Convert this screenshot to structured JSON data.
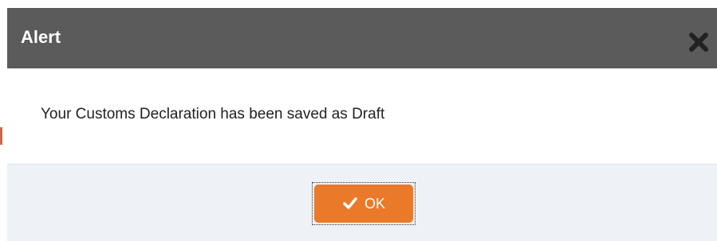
{
  "dialog": {
    "title": "Alert",
    "message": "Your Customs Declaration has been saved as Draft",
    "ok_label": "OK",
    "close_icon": "close-icon",
    "ok_icon": "check-icon"
  },
  "colors": {
    "titlebar": "#5b5b5b",
    "footer": "#eef1f6",
    "ok_button": "#ea7a2a"
  }
}
